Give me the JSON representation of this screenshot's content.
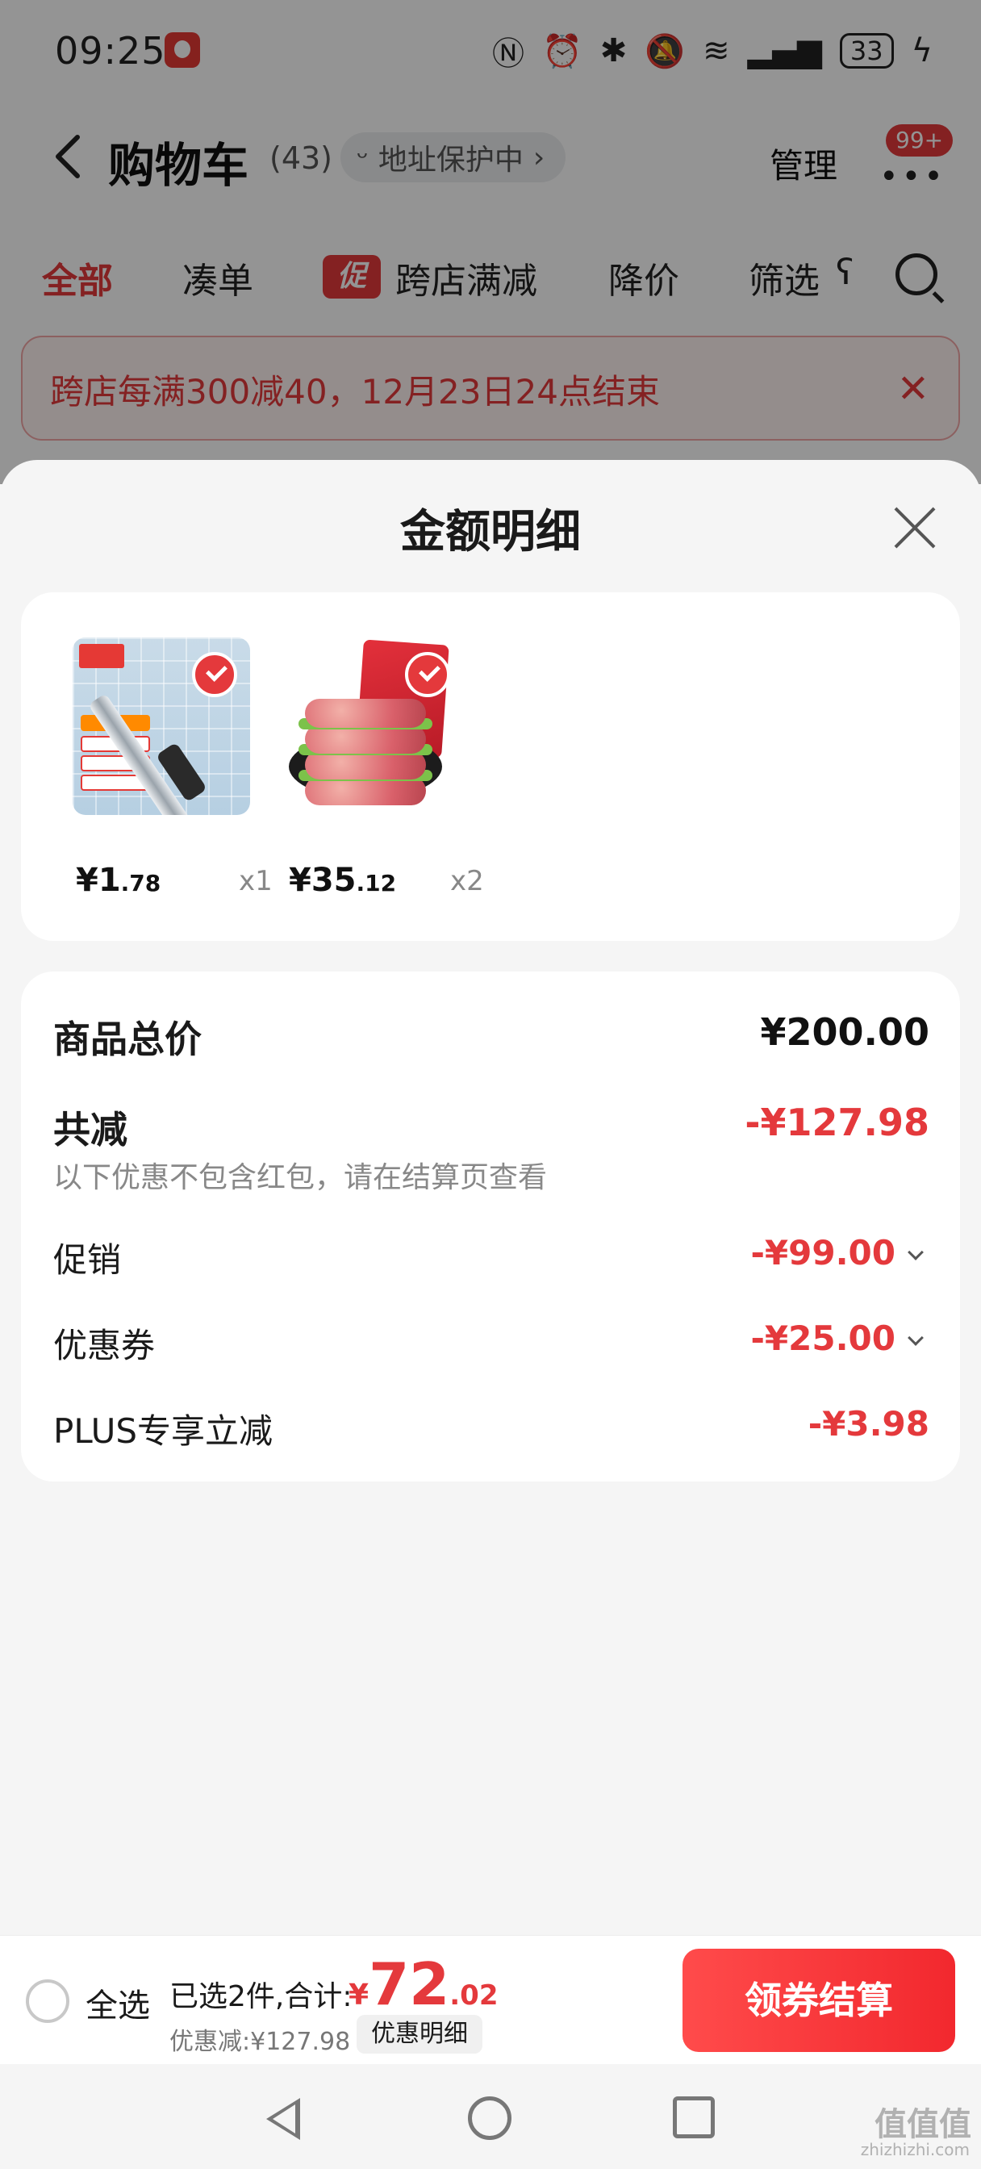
{
  "status_bar": {
    "time": "09:25",
    "battery": "33"
  },
  "header": {
    "title": "购物车",
    "count": "(43)",
    "address_status": "地址保护中",
    "manage_label": "管理",
    "notification_badge": "99+"
  },
  "tabs": [
    {
      "label": "全部",
      "active": true
    },
    {
      "label": "凑单"
    },
    {
      "label": "跨店满减",
      "tag": "促"
    },
    {
      "label": "降价"
    },
    {
      "label": "筛选"
    }
  ],
  "banner": {
    "text": "跨店每满300减40，12月23日24点结束"
  },
  "sheet": {
    "title": "金额明细",
    "items": [
      {
        "price_int": "¥1",
        "price_dec": ".78",
        "qty": "x1",
        "icon": "utility-knife-image"
      },
      {
        "price_int": "¥35",
        "price_dec": ".12",
        "qty": "x2",
        "icon": "beef-patty-image"
      }
    ],
    "summary": {
      "total_label": "商品总价",
      "total_value": "¥200.00",
      "discount_label": "共减",
      "discount_value": "-¥127.98",
      "discount_note": "以下优惠不包含红包，请在结算页查看",
      "rows": [
        {
          "label": "促销",
          "value": "-¥99.00"
        },
        {
          "label": "优惠券",
          "value": "-¥25.00"
        },
        {
          "label": "PLUS专享立减",
          "value": "-¥3.98"
        }
      ]
    }
  },
  "checkout": {
    "select_all": "全选",
    "selected_text": "已选2件,合计:",
    "currency": "¥",
    "total_int": "72",
    "total_dec": ".02",
    "saved_text": "优惠减:¥127.98",
    "detail_label": "优惠明细",
    "button_label": "领券结算"
  },
  "watermark": {
    "text": "值值值",
    "sub": "zhizhizhi.com"
  },
  "colors": {
    "accent": "#e4393c",
    "background": "#f5f5f5"
  }
}
